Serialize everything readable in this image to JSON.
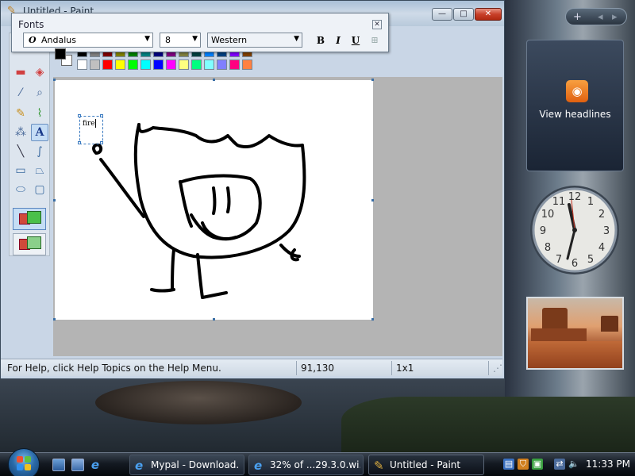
{
  "window": {
    "title": "Untitled - Paint",
    "minimize": "—",
    "maximize": "□",
    "close": "✕"
  },
  "fonts_toolbar": {
    "title": "Fonts",
    "font_name": "Andalus",
    "font_size": "8",
    "script": "Western",
    "bold": "B",
    "italic": "I",
    "underline": "U",
    "close": "✕"
  },
  "canvas": {
    "text_box_content": "fire"
  },
  "status_bar": {
    "help_text": "For Help, click Help Topics on the Help Menu.",
    "coordinates": "91,130",
    "selection_size": "1x1"
  },
  "sidebar": {
    "feed_label": "View headlines",
    "add_button": "+",
    "prev_button": "◂",
    "next_button": "▸"
  },
  "taskbar": {
    "buttons": [
      {
        "label": "Mypal - Download...",
        "icon": "mypal-icon"
      },
      {
        "label": "32% of ...29.3.0.wi...",
        "icon": "browser-download-icon"
      },
      {
        "label": "Untitled - Paint",
        "icon": "paint-icon"
      }
    ],
    "clock": "11:33 PM"
  },
  "palette": {
    "row1": [
      "#000000",
      "#808080",
      "#800000",
      "#808000",
      "#008000",
      "#008080",
      "#000080",
      "#800080",
      "#808040",
      "#004040",
      "#0080ff",
      "#004080",
      "#8000ff",
      "#804000"
    ],
    "row2": [
      "#ffffff",
      "#c0c0c0",
      "#ff0000",
      "#ffff00",
      "#00ff00",
      "#00ffff",
      "#0000ff",
      "#ff00ff",
      "#ffff80",
      "#00ff80",
      "#80ffff",
      "#8080ff",
      "#ff0080",
      "#ff8040"
    ]
  }
}
